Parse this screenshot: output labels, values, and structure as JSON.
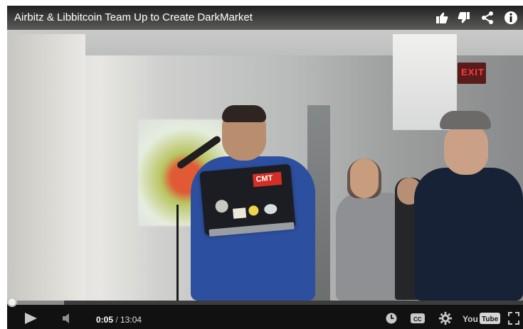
{
  "player": {
    "title": "Airbitz & Libbitcoin Team Up to Create DarkMarket",
    "top_actions": [
      {
        "name": "thumbs-up",
        "icon": "thumbs-up-icon"
      },
      {
        "name": "thumbs-down",
        "icon": "thumbs-down-icon"
      },
      {
        "name": "share",
        "icon": "share-icon"
      },
      {
        "name": "info",
        "icon": "info-icon"
      }
    ],
    "progress": {
      "played_fraction": 0.006,
      "buffered_fraction": 0.11
    },
    "time": {
      "current": "0:05",
      "separator": " / ",
      "duration": "13:04"
    },
    "controls": {
      "play_icon": "play-icon",
      "mute_icon": "volume-muted-icon",
      "clock_icon": "watch-later-icon",
      "cc_icon": "captions-icon",
      "settings_icon": "gear-icon",
      "youtube_icon": "youtube-logo-icon",
      "fullscreen_icon": "fullscreen-icon",
      "youtube_text": "You",
      "youtube_box_text": "Tube"
    },
    "scene": {
      "laptop_sticker_text": "CMT",
      "exit_sign_text": "EXIT"
    },
    "colors": {
      "progress_played": "#cc181e",
      "progress_buffer": "#8b8b8b",
      "control_bar": "#111111"
    }
  }
}
